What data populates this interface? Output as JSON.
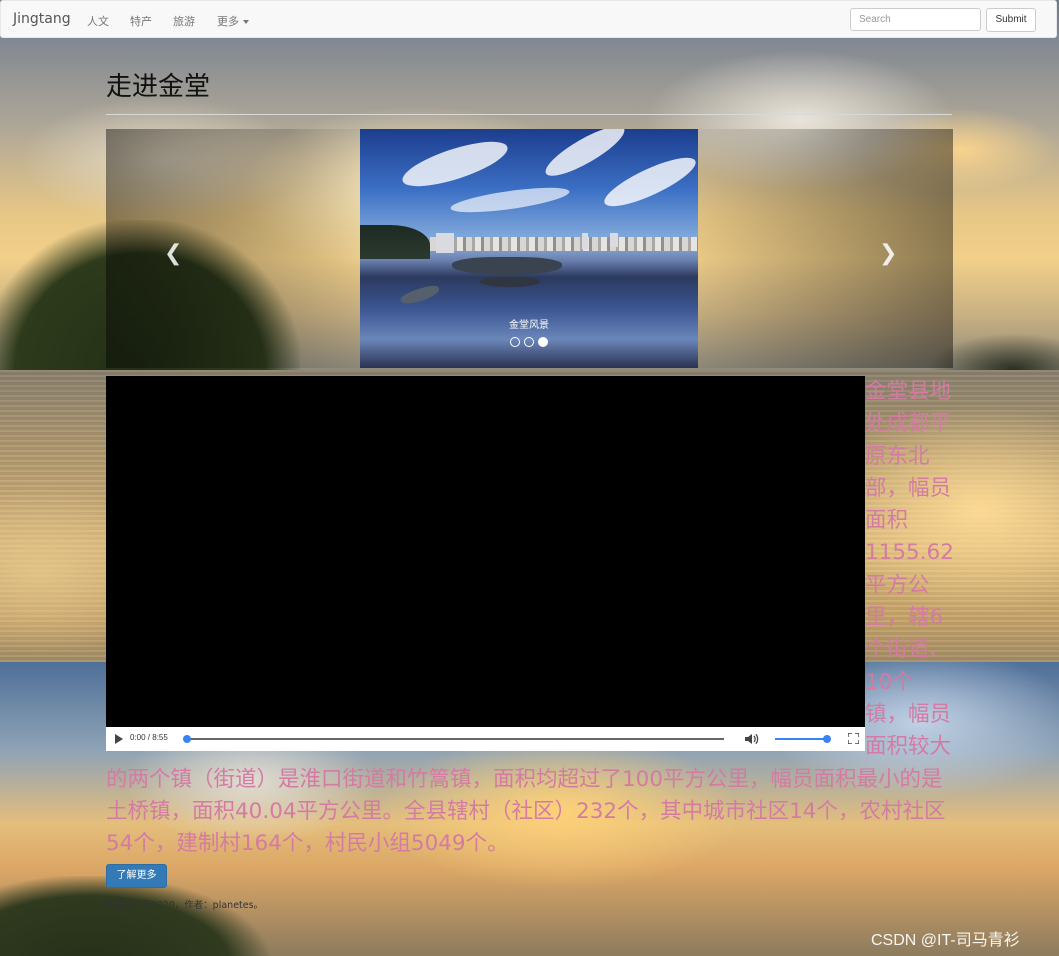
{
  "navbar": {
    "brand": "Jingtang",
    "items": [
      {
        "label": "人文"
      },
      {
        "label": "特产"
      },
      {
        "label": "旅游"
      },
      {
        "label": "更多"
      }
    ],
    "search_placeholder": "Search",
    "submit_label": "Submit"
  },
  "page": {
    "title": "走进金堂"
  },
  "carousel": {
    "caption": "金堂风景",
    "slide_count": 3,
    "active_index": 2,
    "prev_icon": "chevron-left-icon",
    "next_icon": "chevron-right-icon"
  },
  "video": {
    "time": "0:00 / 8:55",
    "progress": 0.0,
    "volume": 1.0
  },
  "description": {
    "text": "金堂县地处成都平原东北部，幅员面积1155.62平方公里，辖6个街道、10个镇，幅员面积较大的两个镇（街道）是淮口街道和竹篙镇，面积均超过了100平方公里，幅员面积最小的是土桥镇，面积40.04平方公里。全县辖村（社区）232个，其中城市社区14个，农村社区54个，建制村164个，村民小组5049个。",
    "color": "#d37ba3"
  },
  "button": {
    "learn_more": "了解更多",
    "color": "#337ab7"
  },
  "footer": {
    "text": "页面制作于2020，作者：planetes。"
  },
  "watermark": {
    "text": "CSDN @IT-司马青衫"
  }
}
